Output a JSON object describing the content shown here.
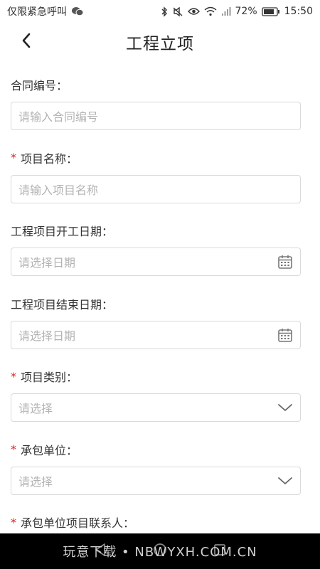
{
  "status_bar": {
    "left_text": "仅限紧急呼叫",
    "battery": "72%",
    "time": "15:50",
    "icons": [
      "wechat-icon",
      "bluetooth-icon",
      "mute-icon",
      "eye-icon",
      "wifi-icon",
      "signal-icon",
      "battery-icon"
    ]
  },
  "header": {
    "title": "工程立项",
    "back_icon": "chevron-left-icon"
  },
  "form": {
    "fields": [
      {
        "label": "合同编号：",
        "required": false,
        "placeholder": "请输入合同编号",
        "type": "text"
      },
      {
        "label": "项目名称：",
        "required": true,
        "placeholder": "请输入项目名称",
        "type": "text"
      },
      {
        "label": "工程项目开工日期：",
        "required": false,
        "placeholder": "请选择日期",
        "type": "date",
        "icon": "calendar-icon"
      },
      {
        "label": "工程项目结束日期：",
        "required": false,
        "placeholder": "请选择日期",
        "type": "date",
        "icon": "calendar-icon"
      },
      {
        "label": "项目类别：",
        "required": true,
        "placeholder": "请选择",
        "type": "select",
        "icon": "chevron-down-icon"
      },
      {
        "label": "承包单位：",
        "required": true,
        "placeholder": "请选择",
        "type": "select",
        "icon": "chevron-down-icon"
      },
      {
        "label": "承包单位项目联系人：",
        "required": true
      }
    ],
    "required_mark": "*"
  },
  "bottom_bar": {
    "watermark": "玩意下载 • NBWYXH.COM.CN",
    "icons": [
      "back-triangle-icon",
      "home-circle-icon",
      "recents-square-icon"
    ]
  },
  "colors": {
    "required": "#e02020",
    "placeholder": "#b3b3b3",
    "border": "#d9d9d9"
  }
}
